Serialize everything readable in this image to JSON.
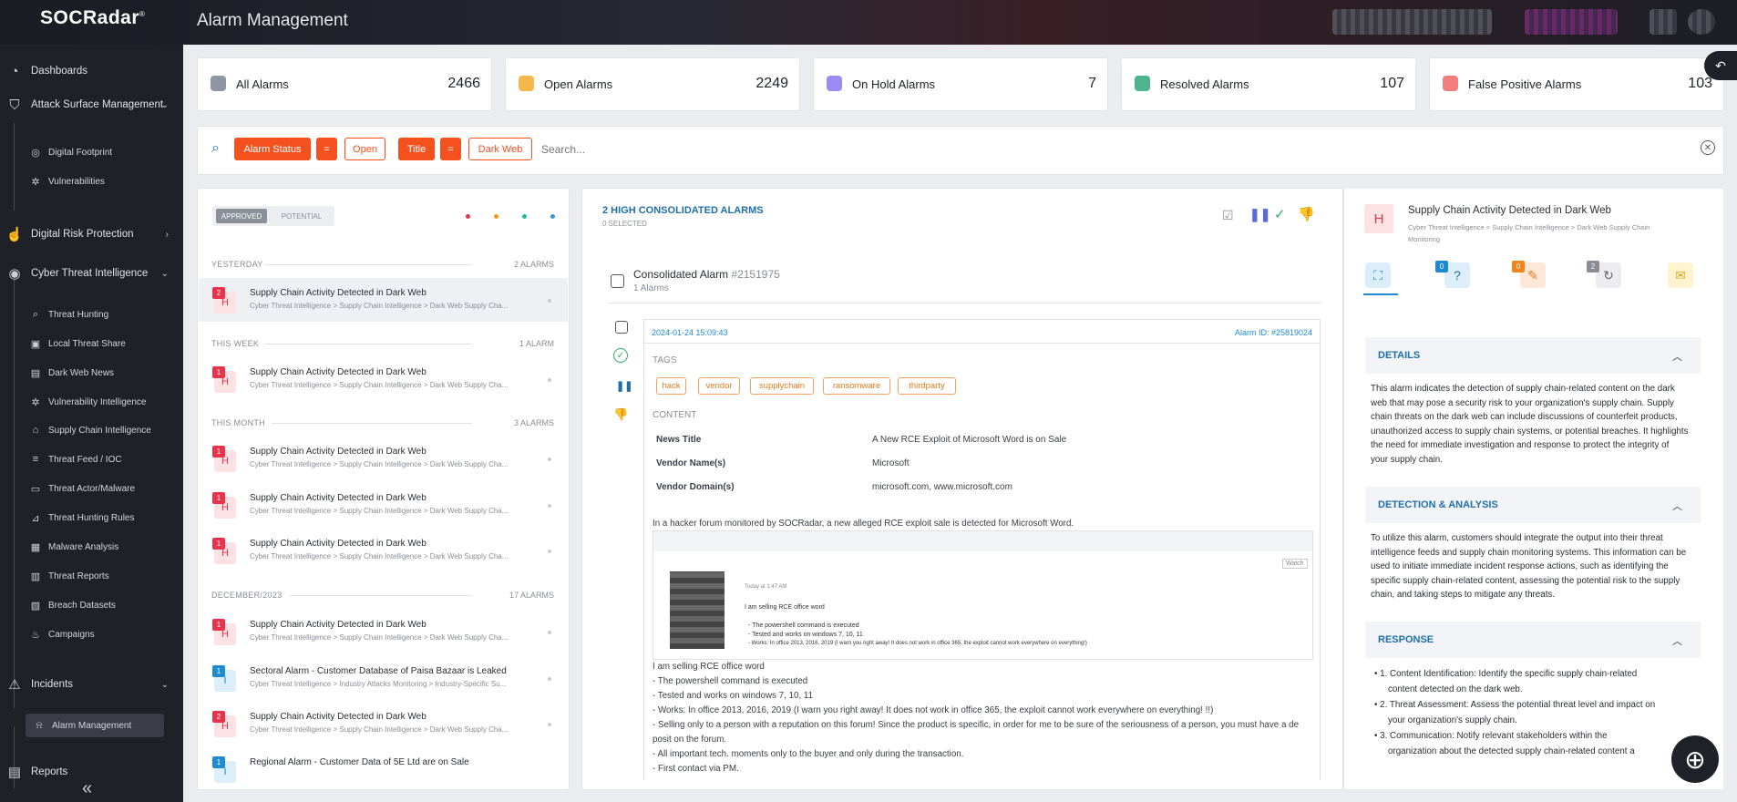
{
  "app": {
    "logo": "SOCRadar",
    "logo_mark": "®",
    "page_title": "Alarm Management"
  },
  "sidebar": {
    "main": [
      {
        "label": "Dashboards",
        "icon": "dashboard-icon"
      },
      {
        "label": "Attack Surface Management",
        "icon": "asm-icon"
      },
      {
        "label": "Digital Risk Protection",
        "icon": "drp-icon"
      },
      {
        "label": "Cyber Threat Intelligence",
        "icon": "cti-icon"
      },
      {
        "label": "Incidents",
        "icon": "incidents-icon"
      },
      {
        "label": "Reports",
        "icon": "reports-icon"
      }
    ],
    "asm_items": [
      "Digital Footprint",
      "Vulnerabilities"
    ],
    "cti_items": [
      "Threat Hunting",
      "Local Threat Share",
      "Dark Web News",
      "Vulnerability Intelligence",
      "Supply Chain Intelligence",
      "Threat Feed / IOC",
      "Threat Actor/Malware",
      "Threat Hunting Rules",
      "Malware Analysis",
      "Threat Reports",
      "Breach Datasets",
      "Campaigns"
    ],
    "incident_items": [
      "Alarm Management"
    ],
    "collapse": "«"
  },
  "stats": [
    {
      "label": "All Alarms",
      "value": "2466",
      "color": "#8f96a3"
    },
    {
      "label": "Open Alarms",
      "value": "2249",
      "color": "#f6b84a"
    },
    {
      "label": "On Hold Alarms",
      "value": "7",
      "color": "#9a8cf2"
    },
    {
      "label": "Resolved Alarms",
      "value": "107",
      "color": "#4cb58e"
    },
    {
      "label": "False Positive Alarms",
      "value": "103",
      "color": "#f47d7d"
    }
  ],
  "filter": {
    "c1": "Alarm Status",
    "eq": "=",
    "c2": "Open",
    "c3": "Title",
    "c4": "Dark Web",
    "placeholder": "Search..."
  },
  "list": {
    "tabs": [
      "APPROVED",
      "POTENTIAL"
    ],
    "dot_colors": [
      "#e8334a",
      "#f39c12",
      "#1abc9c",
      "#3498db"
    ],
    "sections": [
      {
        "label": "YESTERDAY",
        "count": "2 ALARMS"
      },
      {
        "label": "THIS WEEK",
        "count": "1 ALARM"
      },
      {
        "label": "THIS MONTH",
        "count": "3 ALARMS"
      },
      {
        "label": "DECEMBER/2023",
        "count": "17 ALARMS"
      }
    ],
    "rows": [
      {
        "count": "2",
        "letter": "H",
        "title": "Supply Chain Activity Detected in Dark Web",
        "sub": "Cyber Threat Intelligence > Supply Chain Intelligence > Dark Web Supply Cha..."
      },
      {
        "count": "1",
        "letter": "H",
        "title": "Supply Chain Activity Detected in Dark Web",
        "sub": "Cyber Threat Intelligence > Supply Chain Intelligence > Dark Web Supply Cha..."
      },
      {
        "count": "1",
        "letter": "H",
        "title": "Supply Chain Activity Detected in Dark Web",
        "sub": "Cyber Threat Intelligence > Supply Chain Intelligence > Dark Web Supply Cha..."
      },
      {
        "count": "1",
        "letter": "H",
        "title": "Supply Chain Activity Detected in Dark Web",
        "sub": "Cyber Threat Intelligence > Supply Chain Intelligence > Dark Web Supply Cha..."
      },
      {
        "count": "1",
        "letter": "H",
        "title": "Supply Chain Activity Detected in Dark Web",
        "sub": "Cyber Threat Intelligence > Supply Chain Intelligence > Dark Web Supply Cha..."
      },
      {
        "count": "1",
        "letter": "H",
        "title": "Supply Chain Activity Detected in Dark Web",
        "sub": "Cyber Threat Intelligence > Supply Chain Intelligence > Dark Web Supply Cha..."
      },
      {
        "count": "1",
        "letter": "I",
        "title": "Sectoral Alarm - Customer Database of Paisa Bazaar is Leaked",
        "sub": "Cyber Threat Intelligence > Industry Attacks Monitoring > Industry-Specific Su..."
      },
      {
        "count": "2",
        "letter": "H",
        "title": "Supply Chain Activity Detected in Dark Web",
        "sub": "Cyber Threat Intelligence > Supply Chain Intelligence > Dark Web Supply Cha..."
      },
      {
        "count": "1",
        "letter": "I",
        "title": "Regional Alarm - Customer Data of 5E Ltd are on Sale",
        "sub": ""
      }
    ]
  },
  "middle": {
    "header": "2 HIGH CONSOLIDATED ALARMS",
    "selected": "0 SELECTED",
    "consolidated": "Consolidated Alarm",
    "consolidated_id": "#2151975",
    "alarms": "1 Alarms",
    "date": "2024-01-24 15:09:43",
    "alarm_id": "Alarm ID: #25819024",
    "tags_label": "TAGS",
    "tags": [
      "hack",
      "vendor",
      "supplychain",
      "ransomware",
      "thirdparty"
    ],
    "content_label": "CONTENT",
    "fields": [
      {
        "k": "News Title",
        "v": "A New RCE Exploit of Microsoft Word is on Sale"
      },
      {
        "k": "Vendor Name(s)",
        "v": "Microsoft"
      },
      {
        "k": "Vendor Domain(s)",
        "v": "microsoft.com, www.microsoft.com"
      }
    ],
    "intro": "In a hacker forum monitored by SOCRadar, a new alleged RCE exploit sale is detected for Microsoft Word.",
    "shot": {
      "watch": "Watch",
      "time": "Today at 1:47 AM",
      "l1": "I am selling RCE office word",
      "l2": "- The powershell command is executed",
      "l3": "- Tested and works on windows 7, 10, 11",
      "l4": "- Works: In office 2013, 2016, 2019 (I warn you right away! It does not work in office 365, the exploit cannot work everywhere on everything!)"
    },
    "lines": [
      "I am selling RCE office word",
      " - The powershell command is executed",
      " - Tested and works on windows 7, 10, 11",
      " - Works: In office 2013, 2016, 2019 (I warn you right away! It does not work in office 365, the exploit cannot work everywhere on everything! !!)",
      " - Selling only to a person with a reputation on this forum! Since the product is specific, in order for me to be sure of the seriousness of a person, you must have a de",
      "posit on the forum.",
      " - All important tech. moments only to the buyer and only during the transaction.",
      " - First contact via PM."
    ]
  },
  "right": {
    "letter": "H",
    "title": "Supply Chain Activity Detected in Dark Web",
    "crumb1": "Cyber Threat Intelligence > Supply Chain Intelligence > Dark Web Supply Chain",
    "crumb2": "Monitoring",
    "tab_counts": [
      "0",
      "0",
      "2"
    ],
    "details_h": "DETAILS",
    "details": [
      "This alarm indicates the detection of supply chain-related content on the dark",
      "web that may pose a security risk to your organization's supply chain. Supply",
      "chain threats on the dark web can include discussions of counterfeit products,",
      "unauthorized access to supply chain systems, or potential breaches. It highlights",
      "the need for immediate investigation and response to protect the integrity of",
      "your supply chain."
    ],
    "da_h": "DETECTION & ANALYSIS",
    "da": [
      "To utilize this alarm, customers should integrate the output into their threat",
      "intelligence feeds and supply chain monitoring systems. This information can be",
      "used to initiate immediate incident response actions, such as identifying the",
      "specific supply chain-related content, assessing the potential risk to the supply",
      "chain, and taking steps to mitigate any threats."
    ],
    "resp_h": "RESPONSE",
    "resp": [
      "• 1. Content Identification: Identify the specific supply chain-related",
      "content detected on the dark web.",
      "• 2. Threat Assessment: Assess the potential threat level and impact on",
      "your organization's supply chain.",
      "• 3. Communication: Notify relevant stakeholders within the",
      "organization about the detected supply chain-related content a"
    ]
  }
}
